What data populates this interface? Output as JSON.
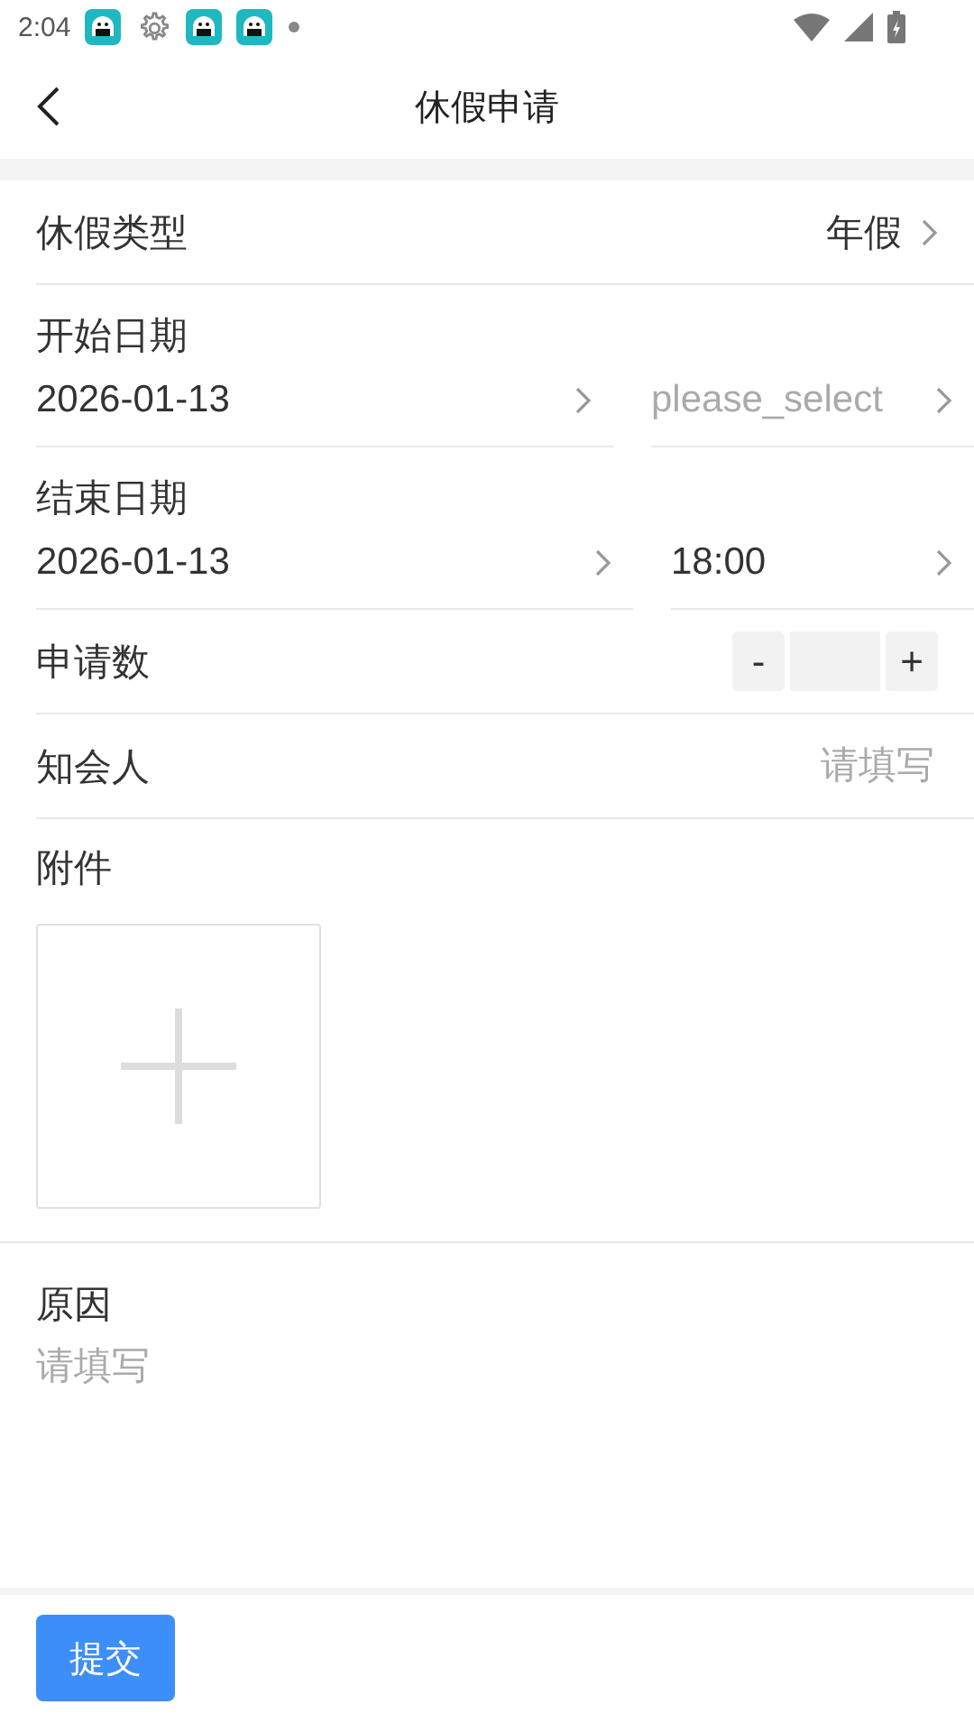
{
  "status_bar": {
    "time": "2:04"
  },
  "header": {
    "title": "休假申请"
  },
  "leave_type": {
    "label": "休假类型",
    "value": "年假"
  },
  "start": {
    "label": "开始日期",
    "date": "2026-01-13",
    "time_placeholder": "please_select"
  },
  "end": {
    "label": "结束日期",
    "date": "2026-01-13",
    "time": "18:00"
  },
  "count": {
    "label": "申请数",
    "decrement": "-",
    "increment": "+"
  },
  "notify": {
    "label": "知会人",
    "placeholder": "请填写"
  },
  "attachment": {
    "label": "附件"
  },
  "reason": {
    "label": "原因",
    "placeholder": "请填写"
  },
  "submit": "提交"
}
